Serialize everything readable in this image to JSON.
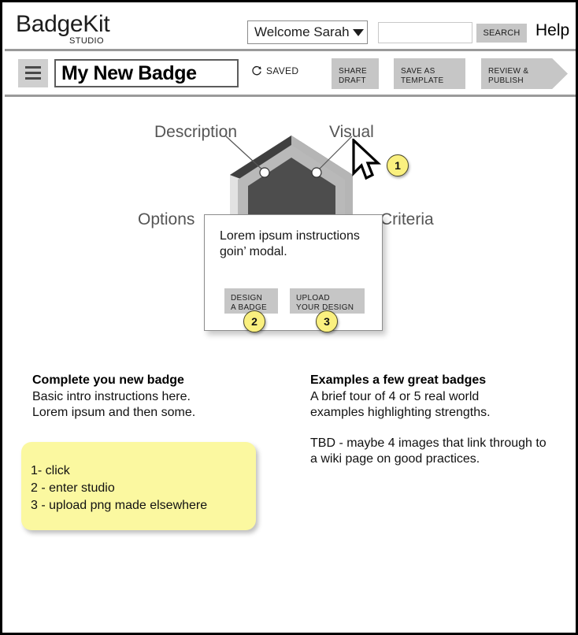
{
  "app": {
    "logo_main": "BadgeKit",
    "logo_sub": "STUDIO"
  },
  "topbar": {
    "welcome_label": "Welcome Sarah",
    "search_value": "",
    "search_placeholder": "",
    "search_button": "SEARCH",
    "help_label": "Help"
  },
  "actionbar": {
    "menu_icon": "hamburger-icon",
    "badge_title_value": "My New Badge",
    "badge_title_placeholder": "Badge name",
    "saved_icon": "refresh-icon",
    "saved_label": "SAVED",
    "share_draft": "SHARE\nDRAFT",
    "save_as_template": "SAVE AS\nTEMPLATE",
    "review_publish": "REVIEW &\nPUBLISH"
  },
  "canvas": {
    "annotations": {
      "description": "Description",
      "visual": "Visual",
      "options": "Options",
      "criteria": "Criteria"
    },
    "cursor_icon": "mouse-pointer-icon",
    "markers": [
      "1",
      "2",
      "3"
    ]
  },
  "modal": {
    "text": "Lorem ipsum instructions goin’ modal.",
    "design_button": "DESIGN\nA BADGE",
    "upload_button": "UPLOAD\nYOUR DESIGN"
  },
  "columns": {
    "left": {
      "heading": "Complete you new badge",
      "line1": "Basic intro instructions here.",
      "line2": "Lorem ipsum and then some."
    },
    "right": {
      "heading": "Examples a few great badges",
      "line1": "A brief tour of 4 or 5 real world",
      "line2": "examples highlighting strengths.",
      "line3": "TBD - maybe 4 images that link through to",
      "line4": "a wiki page on good practices."
    }
  },
  "sticky_note": {
    "line1": "1- click",
    "line2": "2 - enter studio",
    "line3": "3 - upload png made elsewhere",
    "color": "#fbf8a0"
  },
  "colors": {
    "button_gray": "#c6c6c6",
    "marker_yellow": "#faf07f",
    "badge_dark": "#4d4d4d",
    "rule_gray": "#9a9a9a"
  }
}
